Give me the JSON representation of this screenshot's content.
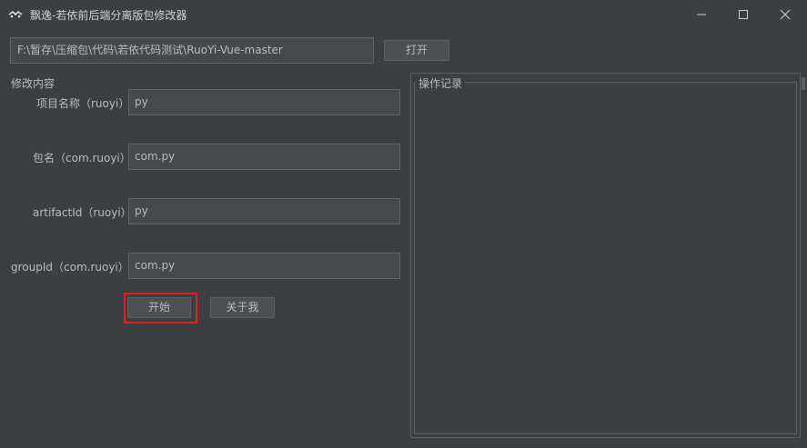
{
  "window": {
    "title": "飘逸-若依前后端分离版包修改器",
    "app_icon": "app-logo-icon",
    "controls": [
      "minimize-icon",
      "maximize-icon",
      "close-icon"
    ]
  },
  "path": {
    "value": "F:\\暂存\\压缩包\\代码\\若依代码测试\\RuoYi-Vue-master",
    "open_label": "打开"
  },
  "form": {
    "section_title": "修改内容",
    "fields": [
      {
        "label": "项目名称（ruoyi）",
        "value": "py"
      },
      {
        "label": "包名（com.ruoyi）",
        "value": "com.py"
      },
      {
        "label": "artifactId（ruoyi）",
        "value": "py"
      },
      {
        "label": "groupId（com.ruoyi）",
        "value": "com.py"
      }
    ],
    "start_label": "开始",
    "about_label": "关于我"
  },
  "log": {
    "title": "操作记录"
  },
  "colors": {
    "background": "#3c3f41",
    "field_bg": "#45494a",
    "highlight": "#e02020"
  }
}
